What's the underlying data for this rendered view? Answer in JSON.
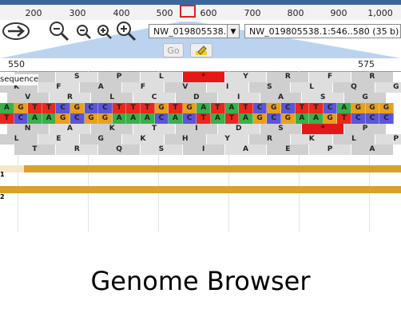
{
  "ruler": {
    "ticks": [
      "200",
      "300",
      "400",
      "500",
      "600",
      "700",
      "800",
      "900",
      "1,000"
    ]
  },
  "toolbar": {
    "chrom_value": "NW_019805538.1",
    "location_value": "NW_019805538.1:546..580 (35 b)",
    "go_label": "Go"
  },
  "scale": {
    "left_pos": "550",
    "right_pos": "575"
  },
  "track": {
    "label": "sequence",
    "row_aa_top_a": [
      "",
      "S",
      "P",
      "L",
      "*",
      "Y",
      "R",
      "F",
      "R"
    ],
    "row_aa_top_b": [
      "K",
      "F",
      "A",
      "F",
      "V",
      "I",
      "S",
      "L",
      "Q",
      "G"
    ],
    "row_aa_top_c": [
      "V",
      "R",
      "L",
      "C",
      "D",
      "I",
      "A",
      "S",
      "G"
    ],
    "fwd_seq": "AGTTCGCCTTTGTGATATCGCTTCAGGG",
    "rev_seq": "TCAAGCGGAAACACTATAGCGAAGTCCC",
    "row_aa_bot_a": [
      "N",
      "A",
      "K",
      "T",
      "I",
      "D",
      "S",
      "*",
      "P"
    ],
    "row_aa_bot_b": [
      "L",
      "E",
      "G",
      "K",
      "H",
      "Y",
      "R",
      "K",
      "L",
      "P"
    ],
    "row_aa_bot_c": [
      "T",
      "R",
      "Q",
      "S",
      "I",
      "A",
      "E",
      "P",
      "A"
    ],
    "feature_labels": [
      "1",
      "2"
    ]
  },
  "caption": "Genome Browser",
  "colors": {
    "A": "#3ab04a",
    "T": "#e8281e",
    "G": "#e8a020",
    "C": "#5b55d8",
    "stop": "#e51818",
    "feature": "#d9a12a"
  }
}
